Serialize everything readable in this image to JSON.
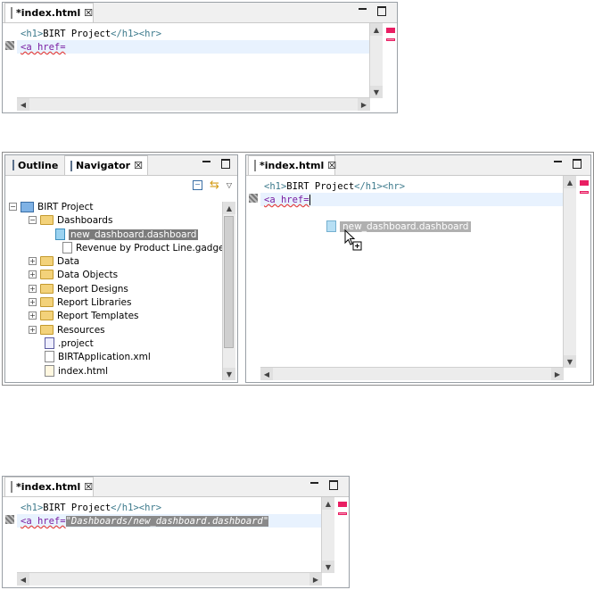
{
  "editor_top": {
    "tab_label": "*index.html",
    "lines": [
      {
        "tag1": "<h1>",
        "text": "BIRT Project",
        "tag2": "</h1><hr>"
      },
      {
        "tag1": "<a href=",
        "text": ""
      }
    ]
  },
  "navigator_panel": {
    "tabs": [
      {
        "label": "Outline"
      },
      {
        "label": "Navigator"
      }
    ],
    "tree": [
      {
        "label": "BIRT Project"
      },
      {
        "label": "Dashboards"
      },
      {
        "label": "new_dashboard.dashboard"
      },
      {
        "label": "Revenue by Product Line.gadget"
      },
      {
        "label": "Data"
      },
      {
        "label": "Data Objects"
      },
      {
        "label": "Report Designs"
      },
      {
        "label": "Report Libraries"
      },
      {
        "label": "Report Templates"
      },
      {
        "label": "Resources"
      },
      {
        "label": ".project"
      },
      {
        "label": "BIRTApplication.xml"
      },
      {
        "label": "index.html"
      }
    ]
  },
  "editor_middle": {
    "tab_label": "*index.html",
    "lines": [
      {
        "tag1": "<h1>",
        "text": "BIRT Project",
        "tag2": "</h1><hr>"
      },
      {
        "tag1": "<a href="
      }
    ],
    "drag_label": "new_dashboard.dashboard"
  },
  "editor_bottom": {
    "tab_label": "*index.html",
    "lines": [
      {
        "tag1": "<h1>",
        "text": "BIRT Project",
        "tag2": "</h1><hr>"
      },
      {
        "tag1": "<a href=",
        "value": "\"Dashboards/new_dashboard.dashboard\""
      }
    ]
  },
  "icons": {
    "html_file": "html-file-icon",
    "close": "close-icon",
    "minimize": "minimize-icon",
    "maximize": "maximize-icon",
    "outline": "outline-icon",
    "navigator": "navigator-icon",
    "collapse_all": "collapse-all-icon",
    "link_editor": "link-with-editor-icon",
    "view_menu": "view-menu-icon"
  },
  "colors": {
    "selection": "#7b7b7b",
    "current_line": "#e8f2fe",
    "tag": "#3d7a8c",
    "error_marker": "#e91e63"
  }
}
